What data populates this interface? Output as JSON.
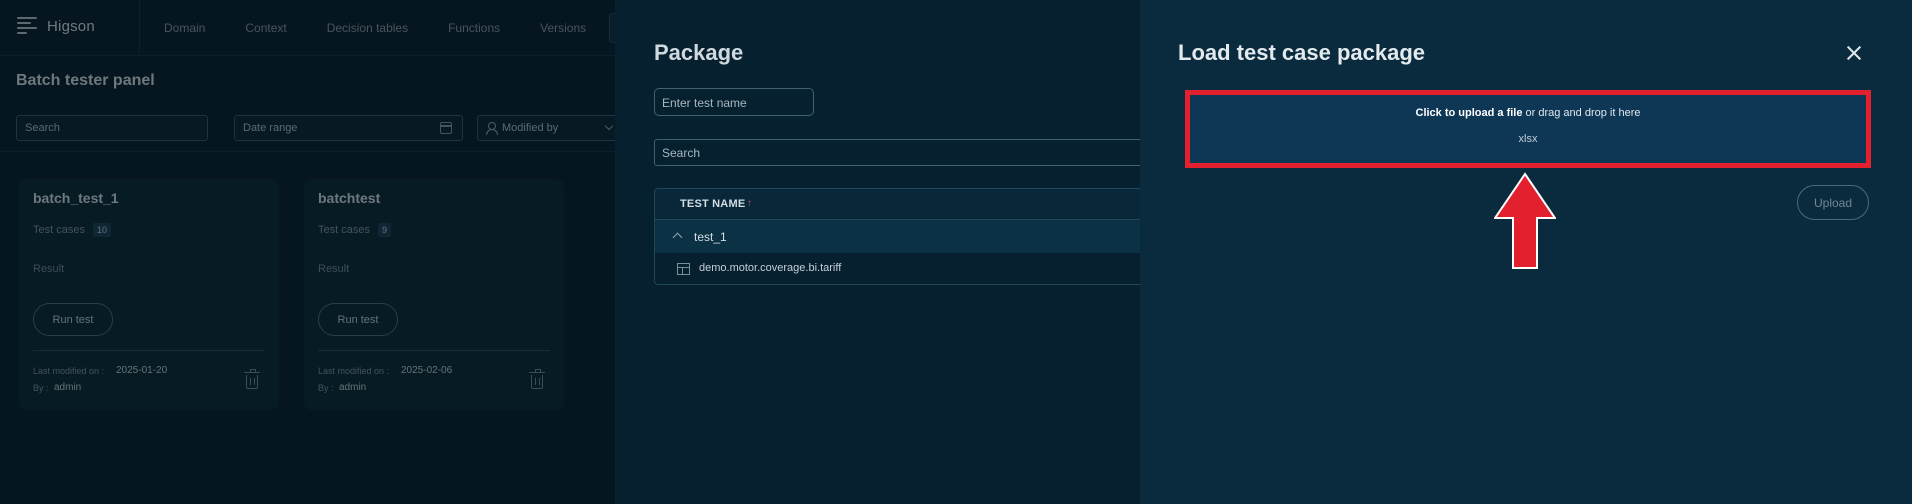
{
  "app": {
    "brand": "Higson",
    "nav": [
      "Domain",
      "Context",
      "Decision tables",
      "Functions",
      "Versions"
    ],
    "panel_title": "Batch tester panel",
    "filters": {
      "search_placeholder": "Search",
      "date_placeholder": "Date range",
      "modified_placeholder": "Modified by"
    },
    "cards": [
      {
        "title": "batch_test_1",
        "test_cases_label": "Test cases",
        "test_cases_count": "10",
        "result_label": "Result",
        "run_label": "Run test",
        "last_modified_label": "Last modified on :",
        "last_modified_value": "2025-01-20",
        "by_label": "By :",
        "by_value": "admin"
      },
      {
        "title": "batchtest",
        "test_cases_label": "Test cases",
        "test_cases_count": "9",
        "result_label": "Result",
        "run_label": "Run test",
        "last_modified_label": "Last modified on :",
        "last_modified_value": "2025-02-06",
        "by_label": "By :",
        "by_value": "admin"
      }
    ]
  },
  "package": {
    "title": "Package",
    "test_name_placeholder": "Enter test name",
    "search_placeholder": "Search",
    "table": {
      "header": "TEST NAME",
      "sort_indicator": "↑",
      "group": "test_1",
      "item": "demo.motor.coverage.bi.tariff"
    }
  },
  "load": {
    "title": "Load test case package",
    "dropzone": {
      "click_text": "Click to upload a file",
      "rest_text": " or drag and drop it here",
      "extension": "xlsx"
    },
    "upload_label": "Upload",
    "highlight_color": "#e2202e"
  }
}
